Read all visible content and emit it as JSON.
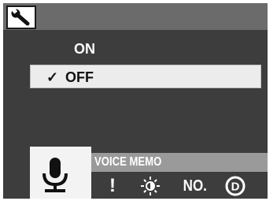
{
  "header": {
    "icon": "wrench-icon"
  },
  "options": [
    {
      "label": "ON",
      "selected": false
    },
    {
      "label": "OFF",
      "selected": true
    }
  ],
  "check_mark": "✓",
  "menu": {
    "selected_label": "VOICE MEMO",
    "selected_icon": "microphone-icon",
    "icons": [
      {
        "name": "exclamation-icon",
        "glyph": "!"
      },
      {
        "name": "brightness-icon",
        "glyph": ""
      },
      {
        "name": "number-icon",
        "glyph": "NO."
      },
      {
        "name": "d-circle-icon",
        "glyph": "D"
      }
    ]
  }
}
